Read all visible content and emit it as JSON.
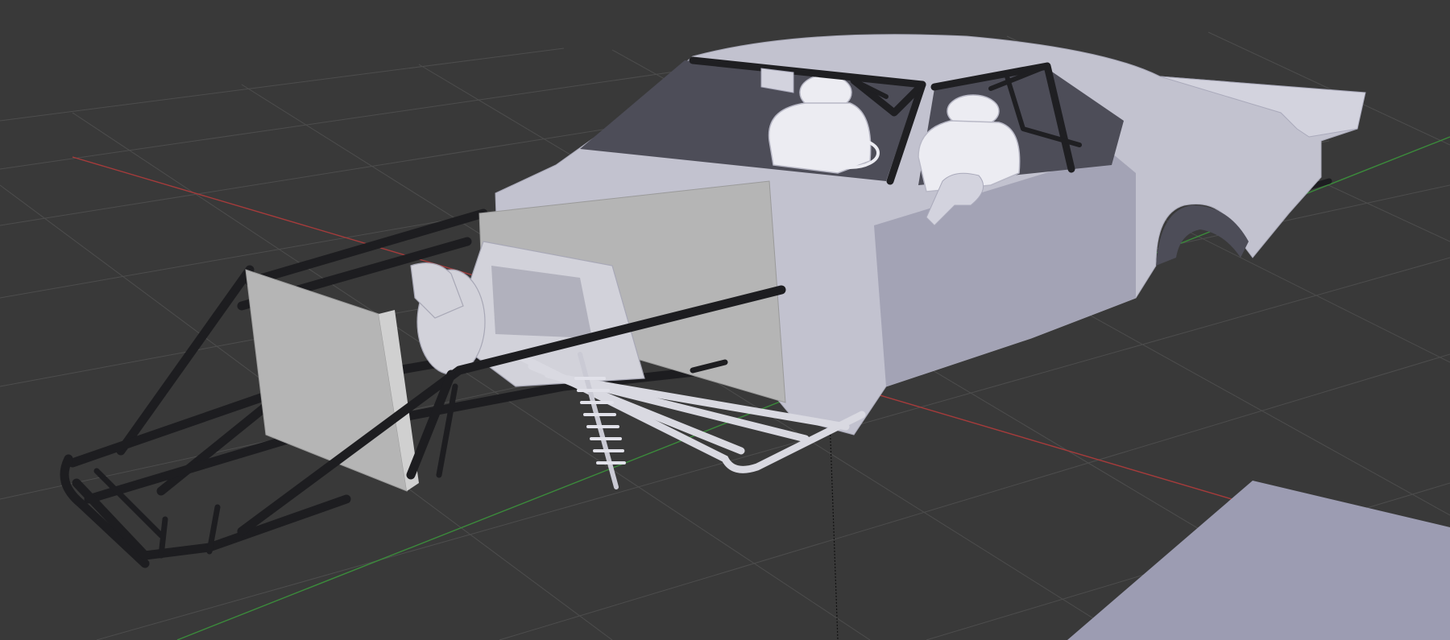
{
  "viewport": {
    "background": "#393939",
    "grid_color": "#4a4a4a",
    "x_axis_color": "#a53b3b",
    "y_axis_color": "#3b8a3b",
    "z_axis_color": "#1a1a1a"
  },
  "model": {
    "body_color": "#c7c7d3",
    "body_shadow": "#9a9aab",
    "body_highlight": "#e4e4ee",
    "frame_color": "#1d1d1f",
    "radiator_color": "#b8b8b8",
    "engine_color": "#d5d5dc",
    "interior_color": "#ececf2"
  },
  "floor_plane": {
    "color": "#9a9ab0"
  }
}
